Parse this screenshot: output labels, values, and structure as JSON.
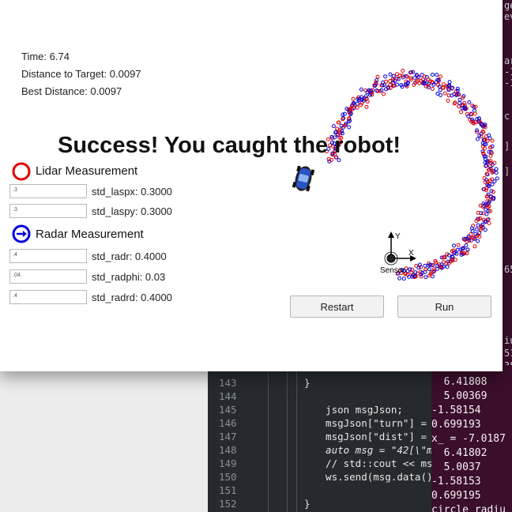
{
  "app": {
    "time_label": "Time: 6.74",
    "distance_label": "Distance to Target: 0.0097",
    "best_distance_label": "Best Distance: 0.0097",
    "headline": "Success! You caught the robot!",
    "colors": {
      "lidar": "#e00000",
      "radar": "#0000dd",
      "car": "#2a55c8"
    }
  },
  "lidar": {
    "legend": "Lidar Measurement",
    "fields": [
      {
        "value": ".3",
        "label": "std_laspx: 0.3000"
      },
      {
        "value": ".3",
        "label": "std_laspy: 0.3000"
      }
    ]
  },
  "radar": {
    "legend": "Radar Measurement",
    "fields": [
      {
        "value": ".4",
        "label": "std_radr: 0.4000"
      },
      {
        "value": ".04.",
        "label": "std_radphi: 0.03"
      },
      {
        "value": ".4",
        "label": "std_radrd: 0.4000"
      }
    ]
  },
  "axes": {
    "y": "Y",
    "x": "X",
    "sensor": "Sensor"
  },
  "buttons": {
    "restart": "Restart",
    "run": "Run"
  },
  "editor": {
    "lines": [
      {
        "num": "143",
        "code": "}"
      },
      {
        "num": "144",
        "code": ""
      },
      {
        "num": "145",
        "code": "  json msgJson;"
      },
      {
        "num": "146",
        "code": "  msgJson[\"turn\"] = "
      },
      {
        "num": "147",
        "code": "  msgJson[\"dist\"] = "
      },
      {
        "num": "148",
        "code": "  auto msg = \"42[\\\"m"
      },
      {
        "num": "149",
        "code": "  // std::cout << ms"
      },
      {
        "num": "150",
        "code": "  ws.send(msg.data()"
      },
      {
        "num": "151",
        "code": ""
      },
      {
        "num": "152",
        "code": "}"
      }
    ]
  },
  "terminal": {
    "lines": [
      "  6.41808",
      "  5.00369",
      "-1.58154",
      "0.699193",
      "x_ = -7.0187",
      "  6.41802",
      "  5.0037",
      "-1.58153",
      "0.699195",
      "circle radiu"
    ]
  },
  "right_edge": {
    "lines": [
      "ge",
      "ev",
      "ar",
      "-1",
      "-1",
      "c",
      "]",
      "]",
      "65",
      "iu",
      "51",
      "38"
    ]
  }
}
